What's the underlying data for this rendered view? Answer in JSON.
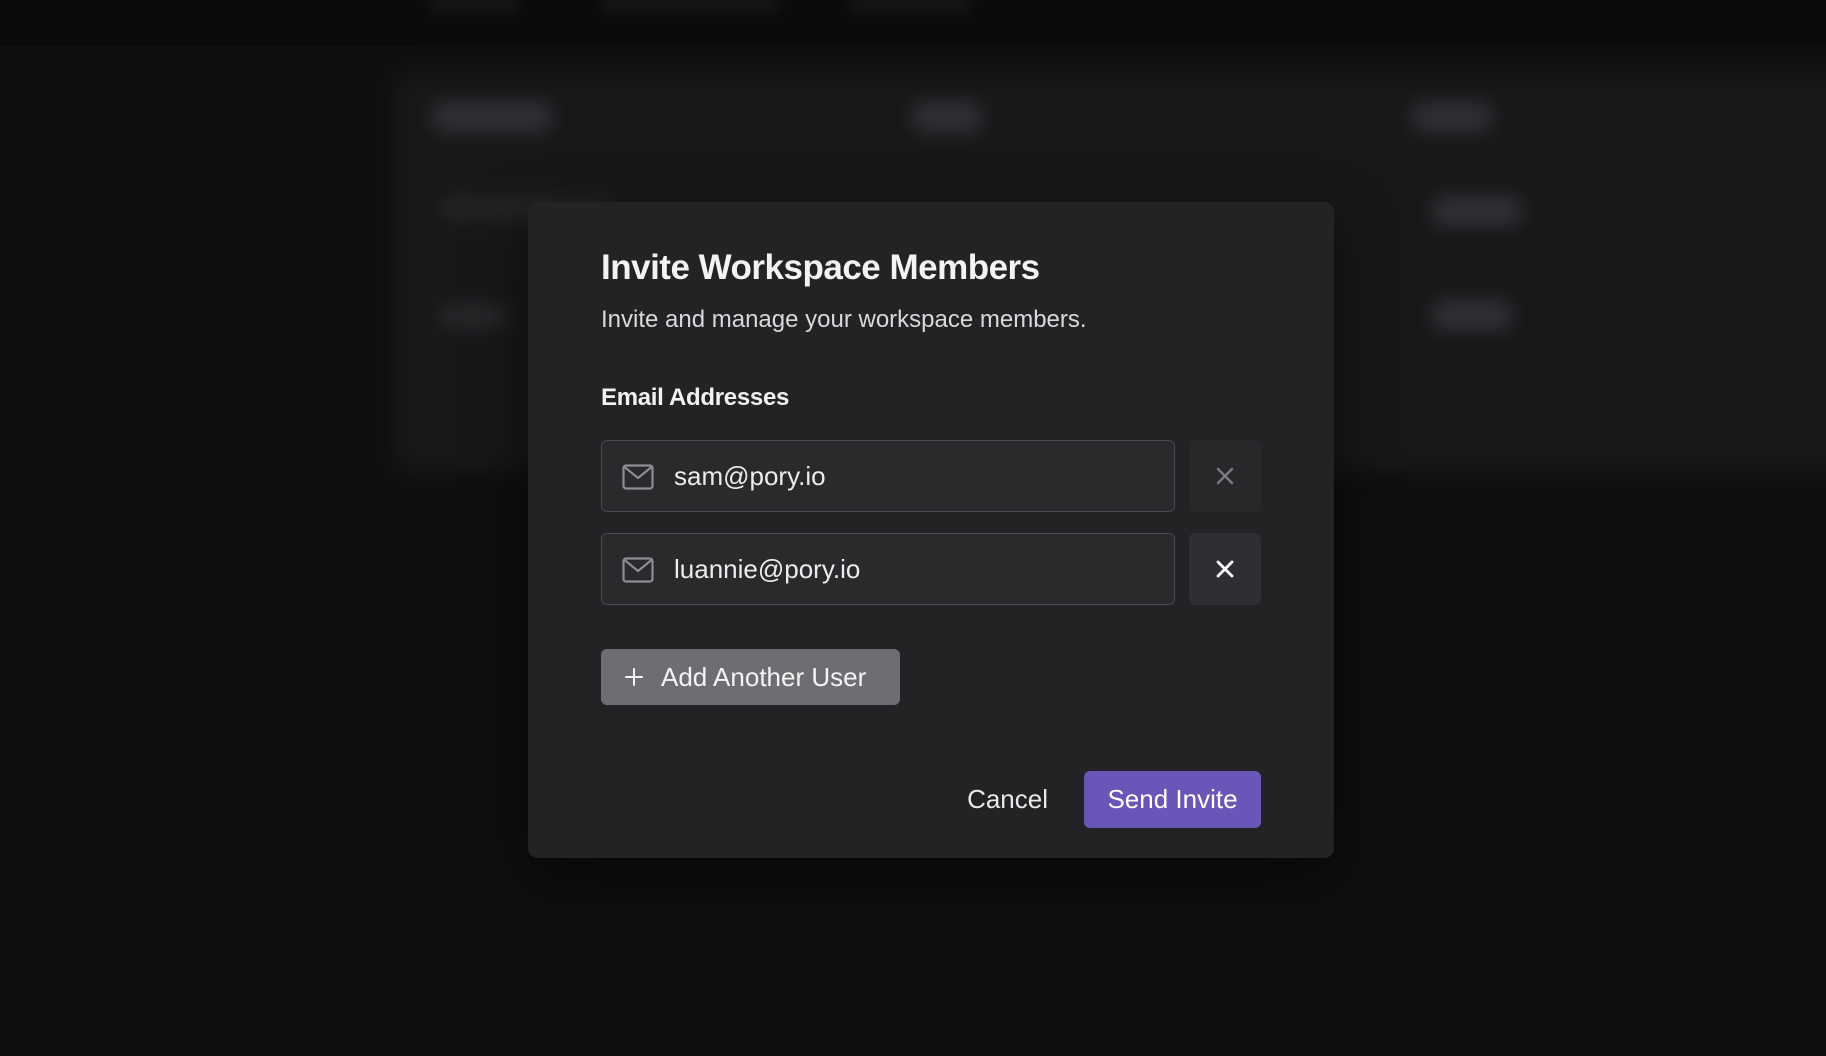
{
  "modal": {
    "title": "Invite Workspace Members",
    "subtitle": "Invite and manage your workspace members.",
    "email_label": "Email Addresses",
    "emails": [
      {
        "value": "sam@pory.io",
        "remove_icon": "close-icon"
      },
      {
        "value": "luannie@pory.io",
        "remove_icon": "close-icon"
      }
    ],
    "add_user_label": "Add Another User",
    "cancel_label": "Cancel",
    "send_label": "Send Invite"
  },
  "icons": {
    "email": "mail-icon",
    "remove": "close-icon",
    "add": "plus-icon"
  },
  "colors": {
    "accent": "#6a55b8",
    "modal_bg": "#232326",
    "page_bg": "#0f0f10"
  }
}
